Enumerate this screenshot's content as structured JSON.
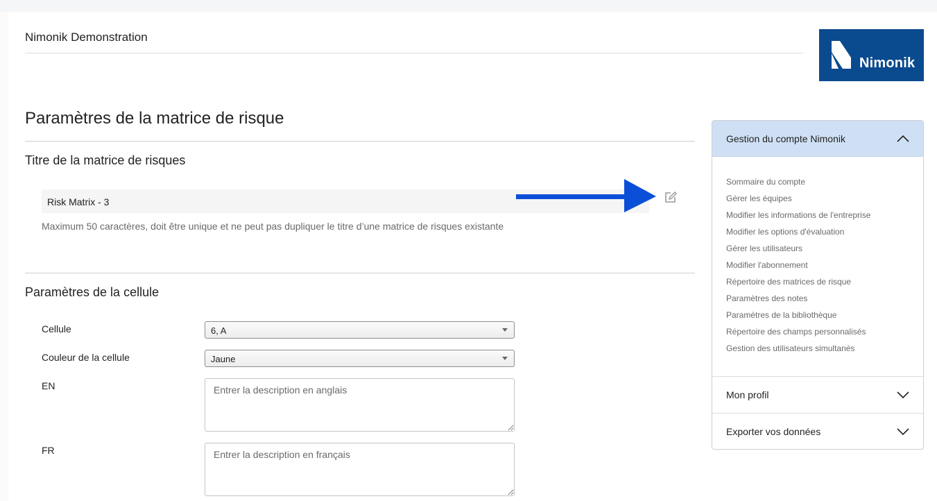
{
  "header": {
    "company_name": "Nimonik Demonstration",
    "logo_text": "Nimonik",
    "logo_color": "#0a4a8e"
  },
  "page": {
    "title": "Paramètres de la matrice de risque",
    "matrix_title_section": {
      "heading": "Titre de la matrice de risques",
      "value": "Risk Matrix - 3",
      "help_text": "Maximum 50 caractères, doit être unique et ne peut pas dupliquer le titre d’une matrice de risques existante",
      "edit_icon": "edit-icon"
    },
    "cell_section": {
      "heading": "Paramètres de la cellule",
      "cell_label": "Cellule",
      "cell_value": "6, A",
      "color_label": "Couleur de la cellule",
      "color_value": "Jaune",
      "en_label": "EN",
      "en_placeholder": "Entrer la description en anglais",
      "fr_label": "FR",
      "fr_placeholder": "Entrer la description en français"
    }
  },
  "annotation": {
    "arrow_color": "#0b4fd9"
  },
  "sidebar": {
    "header": "Gestion du compte Nimonik",
    "header_color": "#cfe0f5",
    "items": [
      "Sommaire du compte",
      "Gérer les équipes",
      "Modifier les informations de l'entreprise",
      "Modifier les options d'évaluation",
      "Gérer les utilisateurs",
      "Modifier l'abonnement",
      "Répertoire des matrices de risque",
      "Paramètres des notes",
      "Paramètres de la bibliothèque",
      "Répertoire des champs personnalisés",
      "Gestion des utilisateurs simultanés"
    ],
    "sections": [
      {
        "label": "Mon profil",
        "icon": "chevron-down-icon"
      },
      {
        "label": "Exporter vos données",
        "icon": "chevron-down-icon"
      }
    ]
  }
}
